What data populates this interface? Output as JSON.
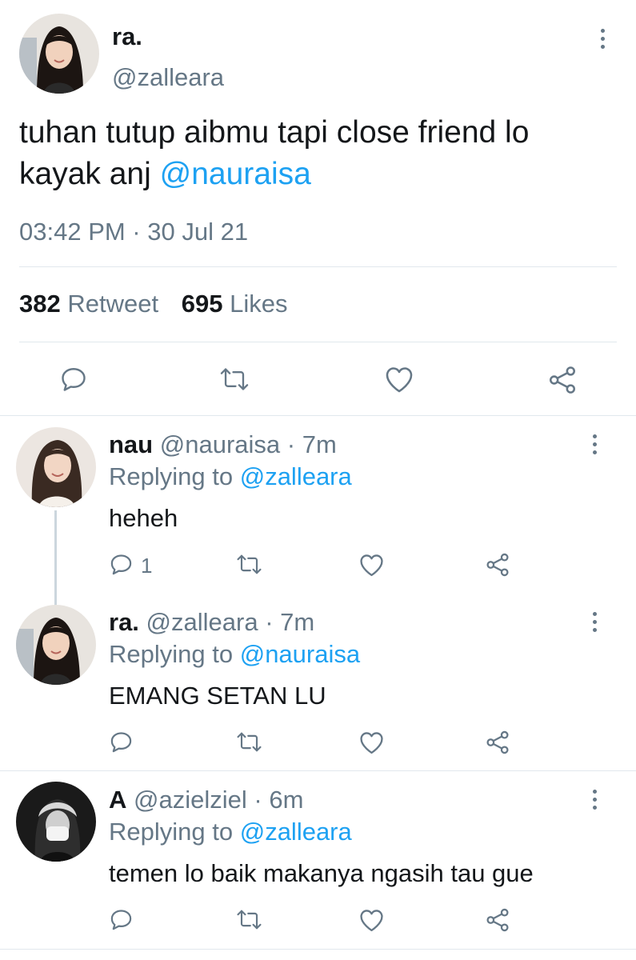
{
  "tweet": {
    "name": "ra.",
    "handle": "@zalleara",
    "text": "tuhan tutup aibmu tapi close friend lo kayak anj",
    "mention": "@nauraisa",
    "time": "03:42 PM · 30 Jul 21",
    "retweets": "382",
    "retweet_label": "Retweet",
    "likes": "695",
    "likes_label": "Likes"
  },
  "replies": [
    {
      "name": "nau",
      "handle": "@nauraisa",
      "age": "7m",
      "replying_prefix": "Replying to",
      "replying_to": "@zalleara",
      "text": "heheh",
      "reply_count": "1"
    },
    {
      "name": "ra.",
      "handle": "@zalleara",
      "age": "7m",
      "replying_prefix": "Replying to",
      "replying_to": "@nauraisa",
      "text": "EMANG SETAN LU",
      "reply_count": ""
    },
    {
      "name": "A",
      "handle": "@azielziel",
      "age": "6m",
      "replying_prefix": "Replying to",
      "replying_to": "@zalleara",
      "text": "temen lo baik makanya ngasih tau gue",
      "reply_count": ""
    }
  ],
  "colors": {
    "accent": "#1da1f2",
    "secondary_text": "#657786",
    "divider": "#e1e8ed"
  },
  "icons": [
    "reply-icon",
    "retweet-icon",
    "like-icon",
    "share-icon",
    "more-icon"
  ]
}
